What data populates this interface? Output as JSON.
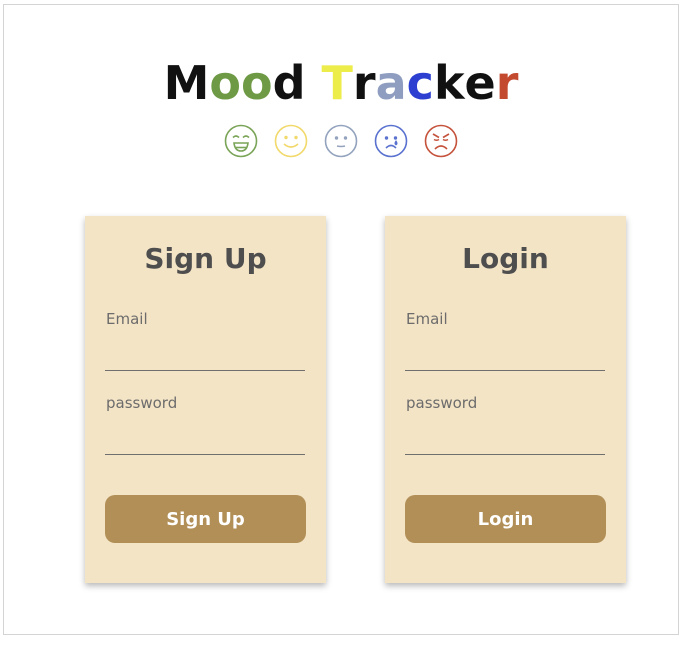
{
  "app": {
    "title_letters": [
      {
        "char": "M",
        "color": "#111111"
      },
      {
        "char": "o",
        "color": "#6e9a45"
      },
      {
        "char": "o",
        "color": "#6e9a45"
      },
      {
        "char": "d",
        "color": "#111111"
      },
      {
        "char": " ",
        "color": "#111111"
      },
      {
        "char": "T",
        "color": "#ecec4a"
      },
      {
        "char": "r",
        "color": "#111111"
      },
      {
        "char": "a",
        "color": "#8f9ec0"
      },
      {
        "char": "c",
        "color": "#2c3fd0"
      },
      {
        "char": "k",
        "color": "#111111"
      },
      {
        "char": "e",
        "color": "#111111"
      },
      {
        "char": "r",
        "color": "#c44a2f"
      }
    ],
    "moods": [
      {
        "icon": "grinning-face-icon",
        "color": "#7aa457"
      },
      {
        "icon": "smiling-face-icon",
        "color": "#f1d96b"
      },
      {
        "icon": "neutral-face-icon",
        "color": "#93a3bd"
      },
      {
        "icon": "sad-face-icon",
        "color": "#5a72cf"
      },
      {
        "icon": "angry-face-icon",
        "color": "#c5533c"
      }
    ]
  },
  "signup": {
    "heading": "Sign Up",
    "email_label": "Email",
    "email_value": "",
    "password_label": "password",
    "password_value": "",
    "button_label": "Sign Up"
  },
  "login": {
    "heading": "Login",
    "email_label": "Email",
    "email_value": "",
    "password_label": "password",
    "password_value": "",
    "button_label": "Login"
  },
  "colors": {
    "card_bg": "#f4e4c6",
    "button_bg": "#b18f56",
    "heading_text": "#4e4e4e"
  }
}
